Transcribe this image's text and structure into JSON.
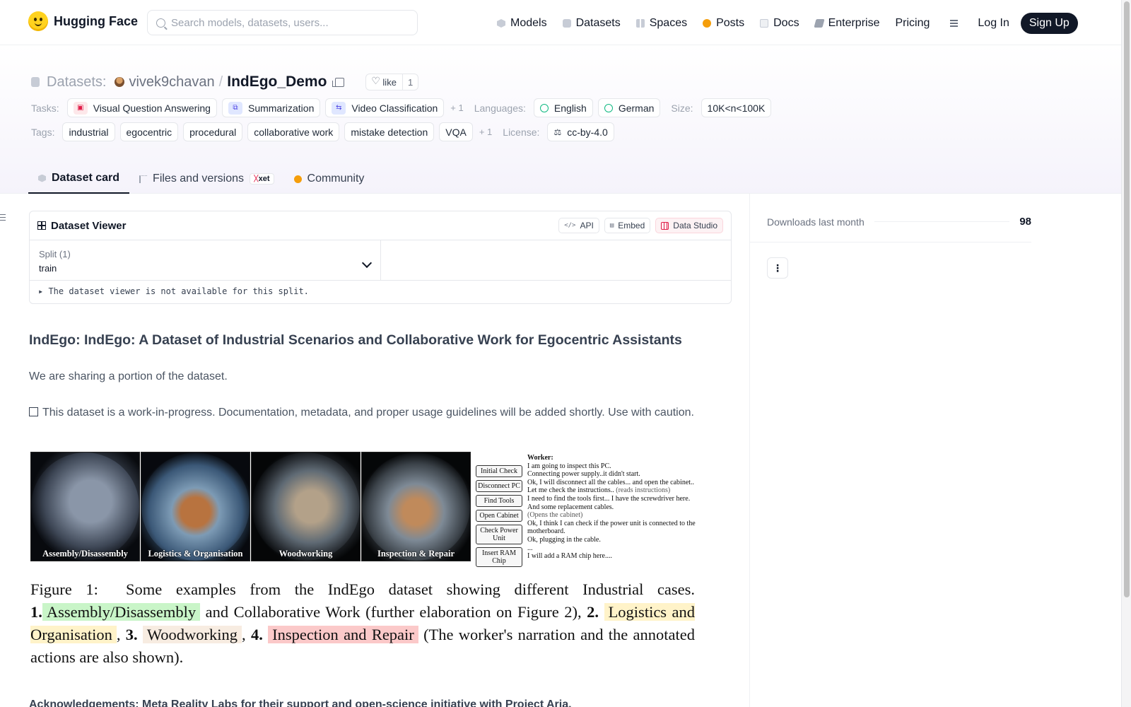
{
  "brand": {
    "name": "Hugging Face"
  },
  "search": {
    "placeholder": "Search models, datasets, users..."
  },
  "nav": {
    "items": [
      {
        "label": "Models",
        "icon": "cube-icon"
      },
      {
        "label": "Datasets",
        "icon": "database-icon"
      },
      {
        "label": "Spaces",
        "icon": "grid-icon"
      },
      {
        "label": "Posts",
        "icon": "speech-bubble-icon"
      },
      {
        "label": "Docs",
        "icon": "book-icon"
      },
      {
        "label": "Enterprise",
        "icon": "enterprise-icon"
      },
      {
        "label": "Pricing"
      }
    ],
    "login": "Log In",
    "signup": "Sign Up"
  },
  "repo": {
    "type_label": "Datasets:",
    "owner": "vivek9chavan",
    "separator": "/",
    "name": "IndEgo_Demo",
    "like_label": "like",
    "like_count": "1"
  },
  "meta": {
    "tasks_label": "Tasks:",
    "tasks": [
      "Visual Question Answering",
      "Summarization",
      "Video Classification"
    ],
    "tasks_more": "+ 1",
    "languages_label": "Languages:",
    "languages": [
      "English",
      "German"
    ],
    "size_label": "Size:",
    "size": "10K<n<100K",
    "tags_label": "Tags:",
    "tags": [
      "industrial",
      "egocentric",
      "procedural",
      "collaborative work",
      "mistake detection",
      "VQA"
    ],
    "tags_more": "+ 1",
    "license_label": "License:",
    "license": "cc-by-4.0"
  },
  "tabs": {
    "dataset_card": "Dataset card",
    "files": "Files and versions",
    "xet_badge": "xet",
    "community": "Community"
  },
  "viewer": {
    "title": "Dataset Viewer",
    "api": "API",
    "embed": "Embed",
    "studio": "Data Studio",
    "split_label": "Split (1)",
    "split_value": "train",
    "note": "The dataset viewer is not available for this split."
  },
  "card": {
    "heading": "IndEgo: IndEgo: A Dataset of Industrial Scenarios and Collaborative Work for Egocentric Assistants",
    "para1": "We are sharing a portion of the dataset.",
    "para2": "This dataset is a work-in-progress. Documentation, metadata, and proper usage guidelines will be added shortly. Use with caution.",
    "ack": "Acknowledgements: Meta Reality Labs for their support and open-science initiative with Project Aria."
  },
  "figure": {
    "photos": [
      "Assembly/Disassembly",
      "Logistics & Organisation",
      "Woodworking",
      "Inspection & Repair"
    ],
    "steps": [
      "Initial Check",
      "Disconnect PC",
      "Find Tools",
      "Open Cabinet",
      "Check Power Unit",
      "Insert RAM Chip"
    ],
    "worker_label": "Worker:",
    "narration": [
      "I am going to inspect this PC.",
      "Connecting power supply..it didn't start.",
      "Ok, I will disconnect all the cables... and open the cabinet..",
      "Let me check the instructions..",
      "I need to find the tools first... I have the screwdriver here.",
      "And some replacement cables.",
      "(Opens the cabinet)",
      "Ok, I think I can check if the power unit is connected to the motherboard.",
      "Ok, plugging in the cable.",
      "...",
      "I will add a RAM chip here...."
    ],
    "narration_aside": "(reads instructions)",
    "caption": {
      "prefix": "Figure 1:",
      "intro": "Some examples from the IndEgo dataset showing different Industrial cases.",
      "n1": "1.",
      "c1": "Assembly/Disassembly",
      "mid1": "and Collaborative Work (further elaboration on Figure 2),",
      "n2": "2.",
      "c2": "Logistics and Organisation",
      "n3": "3.",
      "c3": "Woodworking",
      "n4": "4.",
      "c4": "Inspection and Repair",
      "tail": "(The worker's narration and the annotated actions are also shown)."
    }
  },
  "sidebar": {
    "downloads_label": "Downloads last month",
    "downloads_value": "98"
  }
}
